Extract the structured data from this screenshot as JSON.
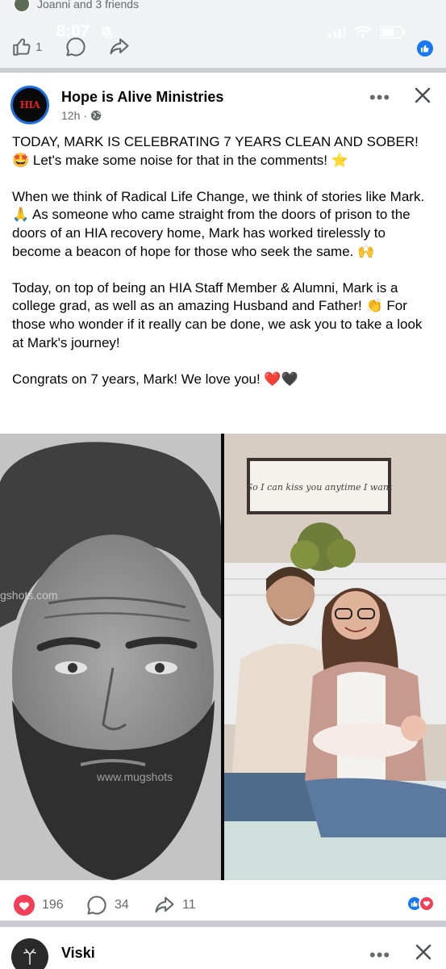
{
  "status_bar": {
    "time": "8:07"
  },
  "previous_post": {
    "friends_text": "Joanni and 3 friends",
    "like_count": "1"
  },
  "post": {
    "page_name": "Hope is Alive Ministries",
    "avatar_text": "HIA",
    "time": "12h",
    "paragraphs": [
      "TODAY, MARK IS CELEBRATING 7 YEARS CLEAN AND SOBER! 🤩 Let's make some noise for that in the comments! ⭐",
      "When we think of Radical Life Change, we think of stories like Mark. 🙏 As someone who came straight from the doors of prison to the doors of an HIA recovery home, Mark has worked tirelessly to become a beacon of hope for those who seek the same. 🙌",
      "Today, on top of being an HIA Staff Member & Alumni, Mark is a college grad, as well as an amazing Husband and Father! 👏 For those who wonder if it really can be done, we ask you to take a look at Mark's journey!",
      "Congrats on 7 years, Mark! We love you! ❤️🖤"
    ],
    "photo_sign_text": "So I can kiss you anytime I want",
    "watermark_text": "mugshots.com",
    "reactions": {
      "love_count": "196",
      "comment_count": "34",
      "share_count": "11"
    }
  },
  "next_post": {
    "page_name": "Viski"
  },
  "colors": {
    "facebook_blue": "#1877f2",
    "love_red": "#f33e58",
    "muted_text": "#65676b"
  },
  "icons": [
    "thumbs-up-icon",
    "comment-icon",
    "share-icon",
    "globe-icon",
    "more-icon",
    "close-icon",
    "heart-icon",
    "bell-off-icon",
    "signal-icon",
    "wifi-icon",
    "battery-icon"
  ]
}
